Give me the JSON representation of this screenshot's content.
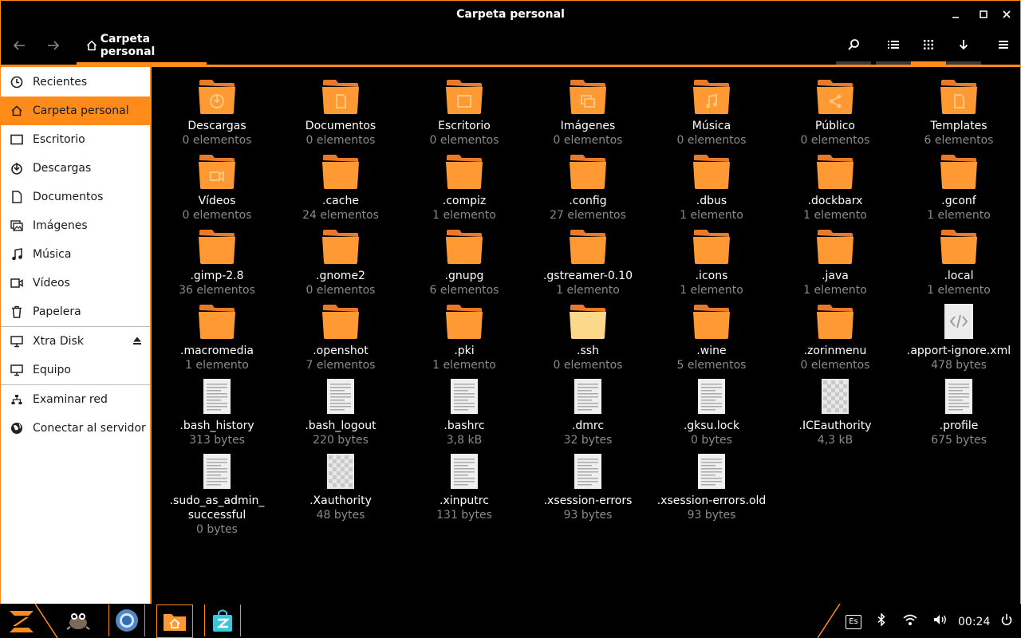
{
  "window": {
    "title": "Carpeta personal"
  },
  "toolbar": {
    "breadcrumb": "Carpeta personal"
  },
  "colors": {
    "accent": "#ff8c1a",
    "background": "#000000",
    "sidebar": "#ffffff"
  },
  "sidebar": {
    "items": [
      {
        "label": "Recientes",
        "icon": "clock-icon"
      },
      {
        "label": "Carpeta personal",
        "icon": "home-icon"
      },
      {
        "label": "Escritorio",
        "icon": "desktop-icon"
      },
      {
        "label": "Descargas",
        "icon": "download-icon"
      },
      {
        "label": "Documentos",
        "icon": "document-icon"
      },
      {
        "label": "Imágenes",
        "icon": "images-icon"
      },
      {
        "label": "Música",
        "icon": "music-icon"
      },
      {
        "label": "Vídeos",
        "icon": "video-icon"
      },
      {
        "label": "Papelera",
        "icon": "trash-icon"
      },
      {
        "label": "Xtra Disk",
        "icon": "drive-icon"
      },
      {
        "label": "Equipo",
        "icon": "computer-icon"
      },
      {
        "label": "Examinar red",
        "icon": "network-icon"
      },
      {
        "label": "Conectar al servidor",
        "icon": "globe-icon"
      }
    ]
  },
  "files": [
    {
      "name": "Descargas",
      "info": "0 elementos",
      "icon": "folder-download-icon"
    },
    {
      "name": "Documentos",
      "info": "0 elementos",
      "icon": "folder-documents-icon"
    },
    {
      "name": "Escritorio",
      "info": "0 elementos",
      "icon": "folder-desktop-icon"
    },
    {
      "name": "Imágenes",
      "info": "0 elementos",
      "icon": "folder-pictures-icon"
    },
    {
      "name": "Música",
      "info": "0 elementos",
      "icon": "folder-music-icon"
    },
    {
      "name": "Público",
      "info": "0 elementos",
      "icon": "folder-public-icon"
    },
    {
      "name": "Templates",
      "info": "6 elementos",
      "icon": "folder-templates-icon"
    },
    {
      "name": "Vídeos",
      "info": "0 elementos",
      "icon": "folder-videos-icon"
    },
    {
      "name": ".cache",
      "info": "24 elementos",
      "icon": "folder-icon"
    },
    {
      "name": ".compiz",
      "info": "1 elemento",
      "icon": "folder-icon"
    },
    {
      "name": ".config",
      "info": "27 elementos",
      "icon": "folder-icon"
    },
    {
      "name": ".dbus",
      "info": "1 elemento",
      "icon": "folder-icon"
    },
    {
      "name": ".dockbarx",
      "info": "1 elemento",
      "icon": "folder-icon"
    },
    {
      "name": ".gconf",
      "info": "1 elemento",
      "icon": "folder-icon"
    },
    {
      "name": ".gimp-2.8",
      "info": "36 elementos",
      "icon": "folder-icon"
    },
    {
      "name": ".gnome2",
      "info": "0 elementos",
      "icon": "folder-icon"
    },
    {
      "name": ".gnupg",
      "info": "6 elementos",
      "icon": "folder-icon"
    },
    {
      "name": ".gstreamer-0.10",
      "info": "1 elemento",
      "icon": "folder-icon"
    },
    {
      "name": ".icons",
      "info": "1 elemento",
      "icon": "folder-icon"
    },
    {
      "name": ".java",
      "info": "1 elemento",
      "icon": "folder-icon"
    },
    {
      "name": ".local",
      "info": "1 elemento",
      "icon": "folder-icon"
    },
    {
      "name": ".macromedia",
      "info": "1 elemento",
      "icon": "folder-icon"
    },
    {
      "name": ".openshot",
      "info": "7 elementos",
      "icon": "folder-icon"
    },
    {
      "name": ".pki",
      "info": "1 elemento",
      "icon": "folder-icon"
    },
    {
      "name": ".ssh",
      "info": "0 elementos",
      "icon": "folder-empty-icon"
    },
    {
      "name": ".wine",
      "info": "5 elementos",
      "icon": "folder-icon"
    },
    {
      "name": ".zorinmenu",
      "info": "0 elementos",
      "icon": "folder-icon"
    },
    {
      "name": ".apport-ignore.xml",
      "info": "478 bytes",
      "icon": "xml-file-icon"
    },
    {
      "name": ".bash_history",
      "info": "313 bytes",
      "icon": "text-file-icon"
    },
    {
      "name": ".bash_logout",
      "info": "220 bytes",
      "icon": "text-file-icon"
    },
    {
      "name": ".bashrc",
      "info": "3,8 kB",
      "icon": "text-file-icon"
    },
    {
      "name": ".dmrc",
      "info": "32 bytes",
      "icon": "text-file-icon"
    },
    {
      "name": ".gksu.lock",
      "info": "0 bytes",
      "icon": "text-file-icon"
    },
    {
      "name": ".ICEauthority",
      "info": "4,3 kB",
      "icon": "binary-file-icon"
    },
    {
      "name": ".profile",
      "info": "675 bytes",
      "icon": "text-file-icon"
    },
    {
      "name": ".sudo_as_admin_ successful",
      "info": "0 bytes",
      "icon": "text-file-icon"
    },
    {
      "name": ".Xauthority",
      "info": "48 bytes",
      "icon": "binary-file-icon"
    },
    {
      "name": ".xinputrc",
      "info": "131 bytes",
      "icon": "text-file-icon"
    },
    {
      "name": ".xsession-errors",
      "info": "93 bytes",
      "icon": "text-file-icon"
    },
    {
      "name": ".xsession-errors.old",
      "info": "93 bytes",
      "icon": "text-file-icon"
    }
  ],
  "taskbar": {
    "apps": [
      "zorin-menu-icon",
      "gimp-icon",
      "chromium-icon",
      "files-icon",
      "software-store-icon"
    ],
    "keyboard_layout": "Es",
    "clock": "00:24"
  }
}
